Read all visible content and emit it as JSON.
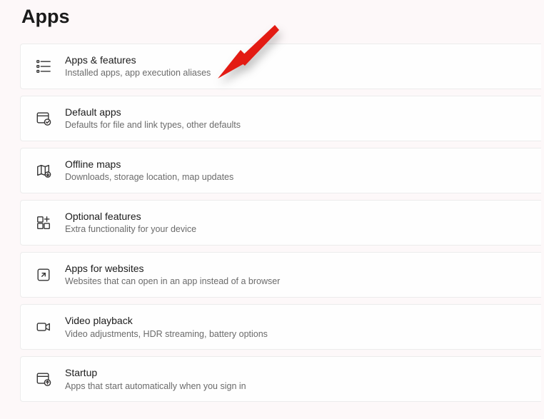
{
  "page": {
    "title": "Apps"
  },
  "items": [
    {
      "title": "Apps & features",
      "subtitle": "Installed apps, app execution aliases"
    },
    {
      "title": "Default apps",
      "subtitle": "Defaults for file and link types, other defaults"
    },
    {
      "title": "Offline maps",
      "subtitle": "Downloads, storage location, map updates"
    },
    {
      "title": "Optional features",
      "subtitle": "Extra functionality for your device"
    },
    {
      "title": "Apps for websites",
      "subtitle": "Websites that can open in an app instead of a browser"
    },
    {
      "title": "Video playback",
      "subtitle": "Video adjustments, HDR streaming, battery options"
    },
    {
      "title": "Startup",
      "subtitle": "Apps that start automatically when you sign in"
    }
  ]
}
